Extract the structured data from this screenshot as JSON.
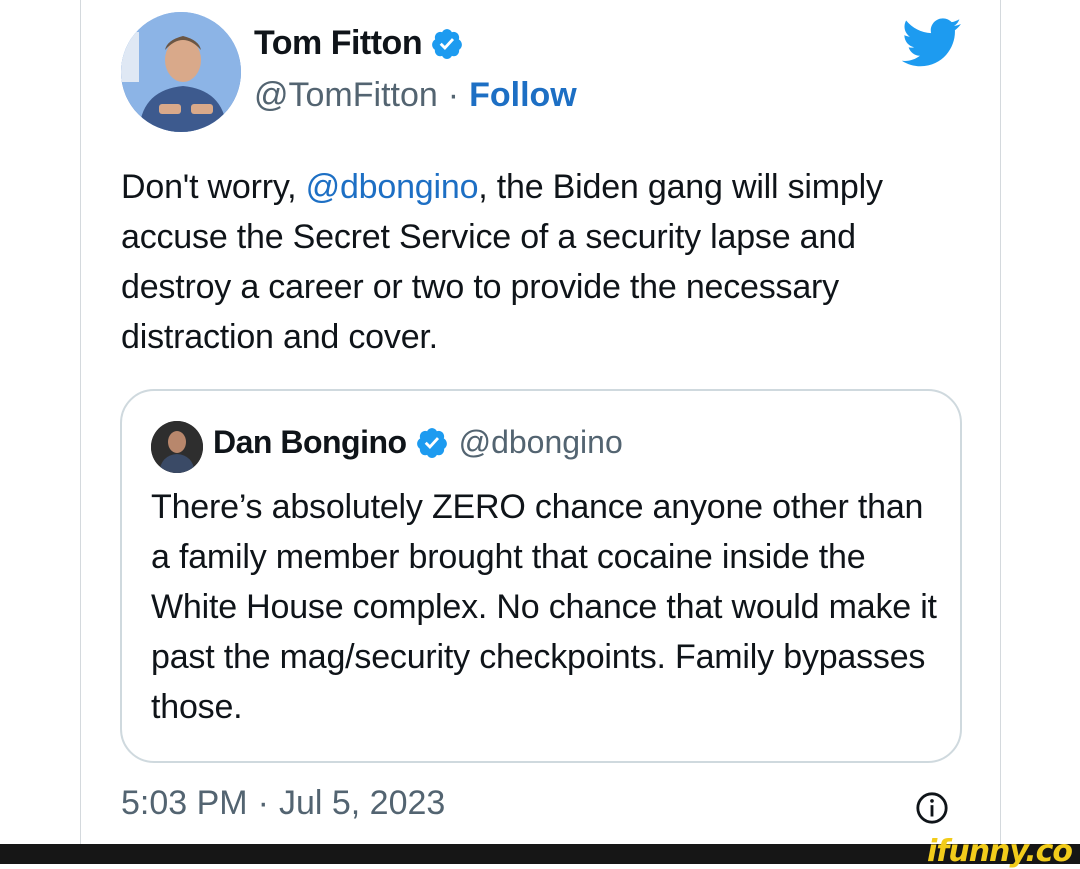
{
  "author": {
    "name": "Tom Fitton",
    "handle": "@TomFitton",
    "separator": "·",
    "follow_label": "Follow"
  },
  "tweet": {
    "text_before": "Don't worry, ",
    "mention": "@dbongino",
    "text_after": ", the Biden gang will simply accuse the Secret Service of a security lapse and destroy a career or two to provide the necessary distraction and cover."
  },
  "quoted": {
    "name": "Dan Bongino",
    "handle": "@dbongino",
    "text": "There’s absolutely ZERO chance anyone other than a family member brought that cocaine inside the White House complex. No chance that would make it past the mag/security checkpoints. Family bypasses those."
  },
  "meta": {
    "time": "5:03 PM",
    "separator": "·",
    "date": "Jul 5, 2023"
  },
  "watermark": "ifunny.co",
  "colors": {
    "link": "#1d6fc4",
    "verified": "#1d9bf0",
    "twitter_brand": "#1d9bf0",
    "watermark": "#f2cc1b"
  },
  "icons": [
    "verified-badge-icon",
    "twitter-bird-icon",
    "info-icon"
  ]
}
